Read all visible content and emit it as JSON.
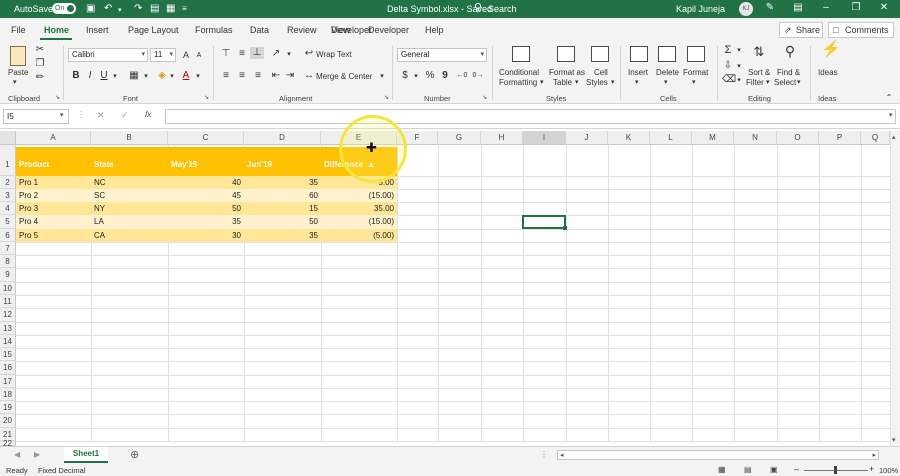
{
  "titlebar": {
    "autosave_label": "AutoSave",
    "autosave_state": "On",
    "document_title": "Delta Symbol.xlsx  -  Saved",
    "search_placeholder": "Search",
    "user_name": "Kapil Juneja",
    "user_initials": "KJ"
  },
  "tabs": [
    "File",
    "Home",
    "Insert",
    "Page Layout",
    "Formulas",
    "Data",
    "Review",
    "Developer",
    "Help"
  ],
  "active_tab": "Home",
  "share": {
    "share_label": "Share",
    "comments_label": "Comments"
  },
  "ribbon": {
    "clipboard": {
      "paste": "Paste",
      "group": "Clipboard"
    },
    "font": {
      "name": "Calibri",
      "size": "11",
      "bold": "B",
      "italic": "I",
      "underline": "U",
      "group": "Font"
    },
    "alignment": {
      "wrap_text": "Wrap Text",
      "merge_center": "Merge & Center",
      "group": "Alignment"
    },
    "number": {
      "format": "General",
      "currency": "$",
      "percent": "%",
      "comma": "9",
      "group": "Number"
    },
    "styles": {
      "conditional_1": "Conditional",
      "conditional_2": "Formatting",
      "format_as_1": "Format as",
      "format_as_2": "Table",
      "cell_styles_1": "Cell",
      "cell_styles_2": "Styles",
      "group": "Styles"
    },
    "cells": {
      "insert": "Insert",
      "delete": "Delete",
      "format": "Format",
      "group": "Cells"
    },
    "editing": {
      "sort_1": "Sort &",
      "sort_2": "Filter",
      "find_1": "Find &",
      "find_2": "Select",
      "group": "Editing"
    },
    "ideas": {
      "label": "Ideas",
      "group": "Ideas"
    }
  },
  "formula_bar": {
    "name_box": "I5",
    "fx": "fx",
    "content": ""
  },
  "columns": [
    "A",
    "B",
    "C",
    "D",
    "E",
    "F",
    "G",
    "H",
    "I",
    "J",
    "K",
    "L",
    "M",
    "N",
    "O",
    "P",
    "Q"
  ],
  "selected_column": "I",
  "rows": [
    "1",
    "2",
    "3",
    "4",
    "5",
    "6",
    "7",
    "8",
    "9",
    "10",
    "11",
    "12",
    "13",
    "14",
    "15",
    "16",
    "17",
    "18",
    "19",
    "20",
    "21",
    "22"
  ],
  "table": {
    "headers": [
      "Product",
      "State",
      "May'19",
      "Jun'19",
      "Difference"
    ],
    "sort_indicator": "▲",
    "data": [
      [
        "Pro 1",
        "NC",
        "40",
        "35",
        "5.00"
      ],
      [
        "Pro 2",
        "SC",
        "45",
        "60",
        "(15.00)"
      ],
      [
        "Pro 3",
        "NY",
        "50",
        "15",
        "35.00"
      ],
      [
        "Pro 4",
        "LA",
        "35",
        "50",
        "(15.00)"
      ],
      [
        "Pro 5",
        "CA",
        "30",
        "35",
        "(5.00)"
      ]
    ]
  },
  "sheets": [
    "Sheet1"
  ],
  "status": {
    "ready": "Ready",
    "mode": "Fixed Decimal",
    "zoom": "100%"
  },
  "colors": {
    "excel_green": "#217346",
    "header_fill": "#ffc000",
    "band_dark": "#ffe699",
    "band_light": "#fff2cc",
    "highlight_ring": "#f4e63a"
  }
}
